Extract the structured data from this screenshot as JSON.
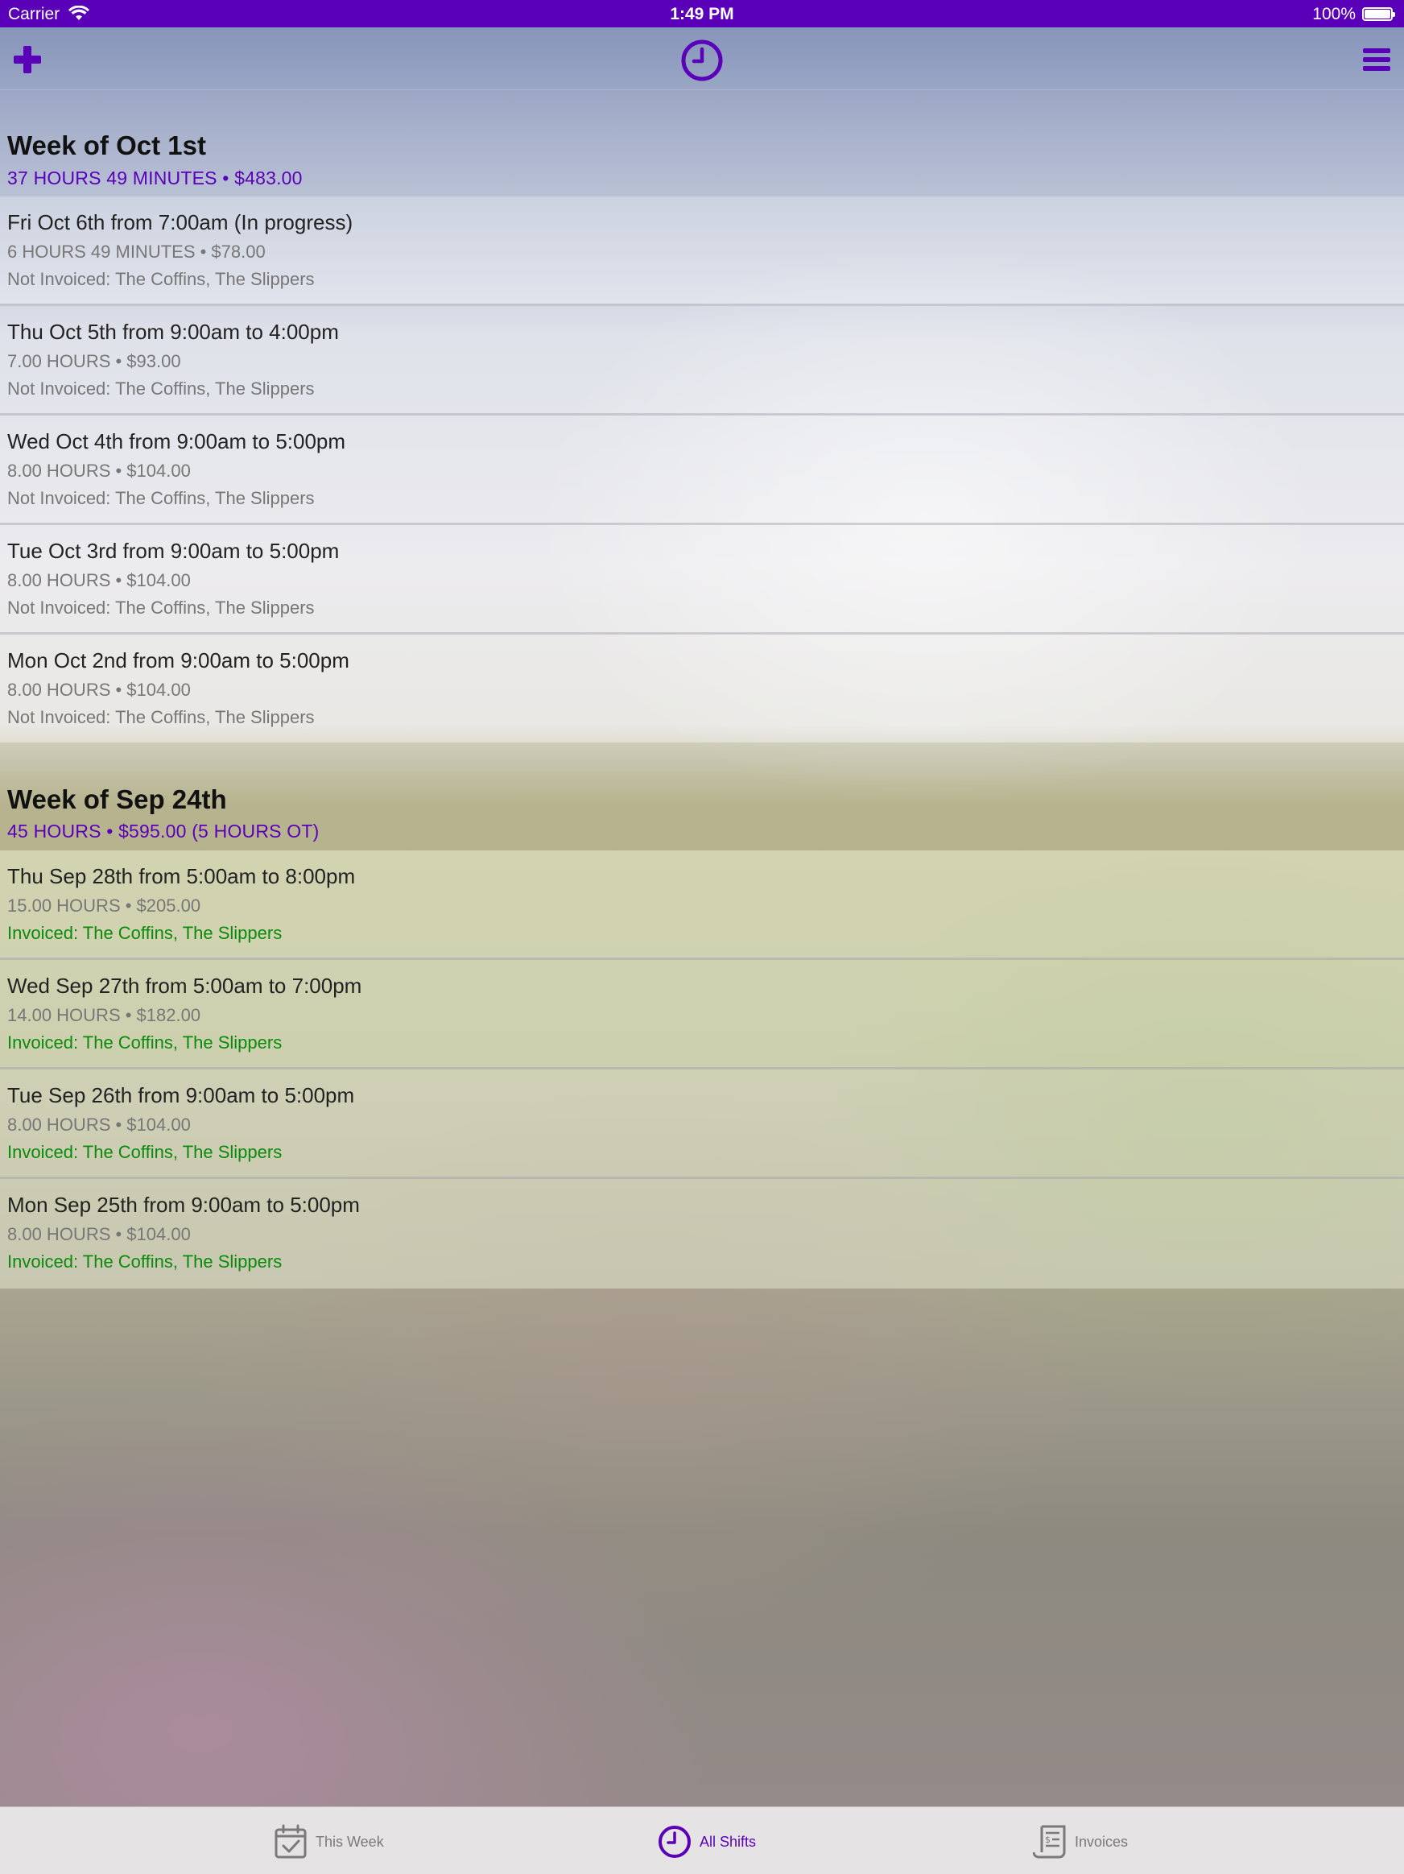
{
  "status_bar": {
    "carrier": "Carrier",
    "time": "1:49 PM",
    "battery": "100%"
  },
  "nav": {
    "add_icon": "plus-icon",
    "center_icon": "clock-icon",
    "menu_icon": "hamburger-menu-icon"
  },
  "accent_color": "#5b00b9",
  "invoiced_color": "#0b8a0b",
  "sections": [
    {
      "title": "Week of Oct 1st",
      "summary": "37 HOURS 49 MINUTES • $483.00",
      "shifts": [
        {
          "title": "Fri Oct 6th from 7:00am (In progress)",
          "meta": "6 HOURS 49 MINUTES • $78.00",
          "status": "Not Invoiced: The Coffins, The Slippers"
        },
        {
          "title": "Thu Oct 5th from 9:00am to 4:00pm",
          "meta": "7.00 HOURS • $93.00",
          "status": "Not Invoiced: The Coffins, The Slippers"
        },
        {
          "title": "Wed Oct 4th from 9:00am to 5:00pm",
          "meta": "8.00 HOURS • $104.00",
          "status": "Not Invoiced: The Coffins, The Slippers"
        },
        {
          "title": "Tue Oct 3rd from 9:00am to 5:00pm",
          "meta": "8.00 HOURS • $104.00",
          "status": "Not Invoiced: The Coffins, The Slippers"
        },
        {
          "title": "Mon Oct 2nd from 9:00am to 5:00pm",
          "meta": "8.00 HOURS • $104.00",
          "status": "Not Invoiced: The Coffins, The Slippers"
        }
      ]
    },
    {
      "title": "Week of Sep 24th",
      "summary": "45 HOURS • $595.00 (5 HOURS OT)",
      "shifts": [
        {
          "title": "Thu Sep 28th from 5:00am to 8:00pm",
          "meta": "15.00 HOURS • $205.00",
          "status": "Invoiced: The Coffins, The Slippers"
        },
        {
          "title": "Wed Sep 27th from 5:00am to 7:00pm",
          "meta": "14.00 HOURS • $182.00",
          "status": "Invoiced: The Coffins, The Slippers"
        },
        {
          "title": "Tue Sep 26th from 9:00am to 5:00pm",
          "meta": "8.00 HOURS • $104.00",
          "status": "Invoiced: The Coffins, The Slippers"
        },
        {
          "title": "Mon Sep 25th from 9:00am to 5:00pm",
          "meta": "8.00 HOURS • $104.00",
          "status": "Invoiced: The Coffins, The Slippers"
        }
      ]
    }
  ],
  "tabs": [
    {
      "label": "This Week",
      "icon": "calendar-check-icon",
      "active": false
    },
    {
      "label": "All Shifts",
      "icon": "clock-icon",
      "active": true
    },
    {
      "label": "Invoices",
      "icon": "invoice-receipt-icon",
      "active": false
    }
  ]
}
